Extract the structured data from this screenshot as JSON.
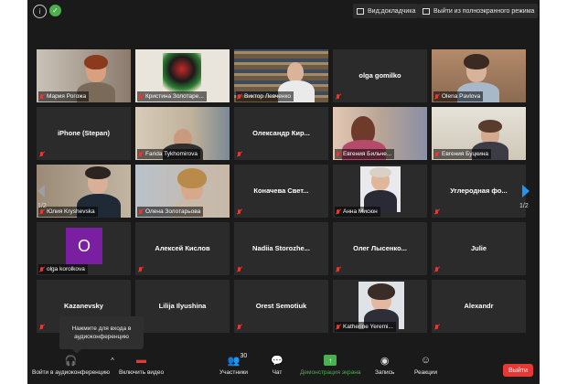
{
  "topbar": {
    "view_label": "Вид:докладчика",
    "exit_fullscreen_label": "Выйти из полноэкранного режима"
  },
  "grid": {
    "pager_left": "1/2",
    "pager_right": "1/2",
    "tiles": [
      {
        "name": "Мария Рогожа",
        "type": "video"
      },
      {
        "name": "Кристина Золотаре...",
        "type": "video"
      },
      {
        "name": "Виктор Левченко",
        "type": "video"
      },
      {
        "name": "olga gomilko",
        "type": "text"
      },
      {
        "name": "Olena Pavlova",
        "type": "video"
      },
      {
        "name": "iPhone (Stepan)",
        "type": "text"
      },
      {
        "name": "Farida Tykhomirova",
        "type": "video"
      },
      {
        "name": "Олександр Кир...",
        "type": "text"
      },
      {
        "name": "Евгения Бильче...",
        "type": "video"
      },
      {
        "name": "Евгения Буцкина",
        "type": "video",
        "highlight": true
      },
      {
        "name": "Юлия Kryshevska",
        "type": "video"
      },
      {
        "name": "Олена Золотарьова",
        "type": "video"
      },
      {
        "name": "Коначева Свет...",
        "type": "text"
      },
      {
        "name": "Анна Мисюн",
        "type": "video"
      },
      {
        "name": "Углеродная фо...",
        "type": "text"
      },
      {
        "name": "olga korolkova",
        "type": "avatar",
        "avatar_letter": "O",
        "avatar_color": "#7b1fa2"
      },
      {
        "name": "Алексей Кислов",
        "type": "text"
      },
      {
        "name": "Nadiia Storozhe...",
        "type": "text"
      },
      {
        "name": "Олег Лысенко...",
        "type": "text"
      },
      {
        "name": "Julie",
        "type": "text"
      },
      {
        "name": "Kazanevsky",
        "type": "text"
      },
      {
        "name": "Lilija Ilyushina",
        "type": "text"
      },
      {
        "name": "Orest Semotiuk",
        "type": "text"
      },
      {
        "name": "Katherine Yeremi...",
        "type": "video"
      },
      {
        "name": "Alexandr",
        "type": "text"
      }
    ]
  },
  "tooltip": {
    "text_line1": "Нажмите для входа в",
    "text_line2": "аудиоконференцию"
  },
  "bottombar": {
    "audio_label": "Войти в аудиоконференцию",
    "video_label": "Включить видео",
    "participants_label": "Участники",
    "participants_count": "30",
    "chat_label": "Чат",
    "share_label": "Демонстрация экрана",
    "record_label": "Запись",
    "reactions_label": "Реакции",
    "exit_label": "Выйти"
  },
  "colors": {
    "background": "#1a1a1a",
    "tile": "#2b2b2b",
    "highlight": "#d4e157",
    "share_green": "#4caf50",
    "exit_red": "#e53935"
  }
}
